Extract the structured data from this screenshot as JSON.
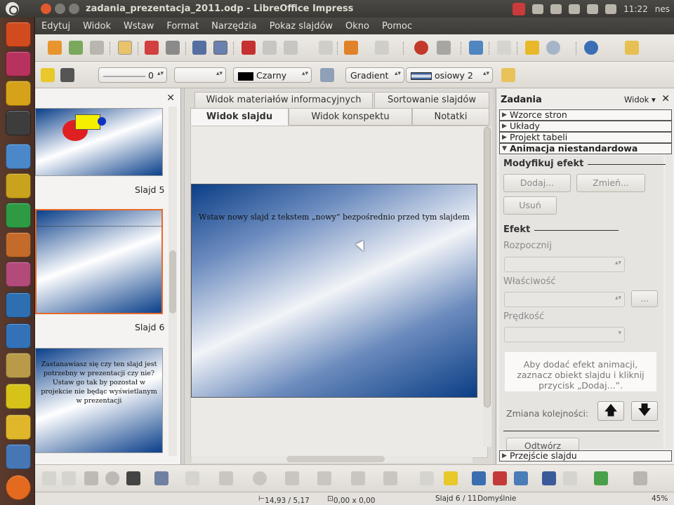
{
  "window": {
    "title": "zadania_prezentacja_2011.odp - LibreOffice Impress"
  },
  "tray": {
    "time": "11:22",
    "user": "nes"
  },
  "menu": [
    "Edytuj",
    "Widok",
    "Wstaw",
    "Format",
    "Narzędzia",
    "Pokaz slajdów",
    "Okno",
    "Pomoc"
  ],
  "format_bar": {
    "line_width": "0",
    "color_name": "Czarny",
    "fill_type": "Gradient",
    "fill_name": "osiowy 2"
  },
  "slides_panel": {
    "captions": [
      "Slajd 5",
      "Slajd 6"
    ],
    "slide7_text": "Zastanawiasz się czy ten slajd jest potrzebny w prezentacji czy nie? Ustaw go tak by pozostał w projekcie nie będąc wyświetlanym w prezentacji"
  },
  "tabs": {
    "row1": [
      "Widok materiałów informacyjnych",
      "Sortowanie slajdów"
    ],
    "row2": [
      "Widok slajdu",
      "Widok konspektu",
      "Notatki"
    ]
  },
  "slide": {
    "text": "Wstaw nowy slajd z tekstem „nowy” bezpośrednio przed tym slajdem"
  },
  "task_panel": {
    "title": "Zadania",
    "view_label": "Widok",
    "sections": [
      "Wzorce stron",
      "Układy",
      "Projekt tabeli",
      "Animacja niestandardowa"
    ],
    "modify_group": "Modyfikuj efekt",
    "buttons": {
      "add": "Dodaj...",
      "change": "Zmień...",
      "remove": "Usuń",
      "more": "..."
    },
    "effect_group": "Efekt",
    "labels": {
      "start": "Rozpocznij",
      "property": "Właściwość",
      "speed": "Prędkość"
    },
    "hint": "Aby dodać efekt animacji, zaznacz obiekt slajdu i kliknij przycisk „Dodaj...”.",
    "order_label": "Zmiana kolejności:",
    "play": "Odtwórz",
    "transition_section": "Przejście slajdu"
  },
  "status": {
    "position": "14,93 / 5,17",
    "size": "0,00 x 0,00",
    "slide": "Slajd 6 / 11",
    "layout": "Domyślnie",
    "zoom": "45%"
  },
  "colors": {
    "accent_orange": "#e8692a",
    "slide_blue": "#0b3e86"
  }
}
